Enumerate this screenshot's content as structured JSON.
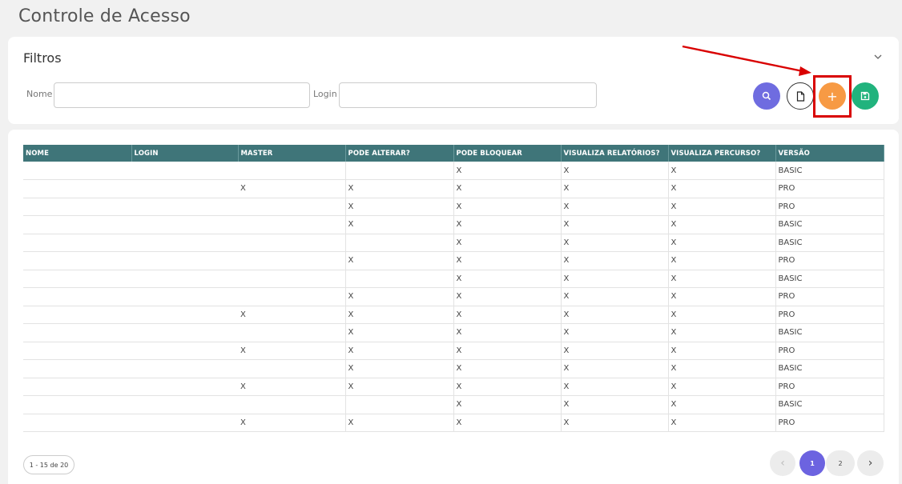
{
  "page": {
    "title": "Controle de Acesso"
  },
  "filters": {
    "title": "Filtros",
    "nome_label": "Nome",
    "nome_value": "",
    "login_label": "Login",
    "login_value": "",
    "add_label": "+"
  },
  "colors": {
    "header": "#3f7579",
    "search": "#6f6ce0",
    "add": "#f79a44",
    "save": "#21b37d",
    "pager_active": "#6c63e0",
    "annotation": "#d90000"
  },
  "table": {
    "columns": [
      "NOME",
      "LOGIN",
      "MASTER",
      "PODE ALTERAR?",
      "PODE BLOQUEAR",
      "VISUALIZA RELATÓRIOS?",
      "VISUALIZA PERCURSO?",
      "VERSÃO"
    ],
    "rows": [
      [
        "",
        "",
        "",
        "",
        "X",
        "X",
        "X",
        "BASIC"
      ],
      [
        "",
        "",
        "X",
        "X",
        "X",
        "X",
        "X",
        "PRO"
      ],
      [
        "",
        "",
        "",
        "X",
        "X",
        "X",
        "X",
        "PRO"
      ],
      [
        "",
        "",
        "",
        "X",
        "X",
        "X",
        "X",
        "BASIC"
      ],
      [
        "",
        "",
        "",
        "",
        "X",
        "X",
        "X",
        "BASIC"
      ],
      [
        "",
        "",
        "",
        "X",
        "X",
        "X",
        "X",
        "PRO"
      ],
      [
        "",
        "",
        "",
        "",
        "X",
        "X",
        "X",
        "BASIC"
      ],
      [
        "",
        "",
        "",
        "X",
        "X",
        "X",
        "X",
        "PRO"
      ],
      [
        "",
        "",
        "X",
        "X",
        "X",
        "X",
        "X",
        "PRO"
      ],
      [
        "",
        "",
        "",
        "X",
        "X",
        "X",
        "X",
        "BASIC"
      ],
      [
        "",
        "",
        "X",
        "X",
        "X",
        "X",
        "X",
        "PRO"
      ],
      [
        "",
        "",
        "",
        "X",
        "X",
        "X",
        "X",
        "BASIC"
      ],
      [
        "",
        "",
        "X",
        "X",
        "X",
        "X",
        "X",
        "PRO"
      ],
      [
        "",
        "",
        "",
        "",
        "X",
        "X",
        "X",
        "BASIC"
      ],
      [
        "",
        "",
        "X",
        "X",
        "X",
        "X",
        "X",
        "PRO"
      ]
    ]
  },
  "pagination": {
    "range": "1 - 15 de 20",
    "pages": [
      "1",
      "2"
    ],
    "current": "1",
    "prev_icon": "chevron-left-icon",
    "next_icon": "chevron-right-icon"
  }
}
